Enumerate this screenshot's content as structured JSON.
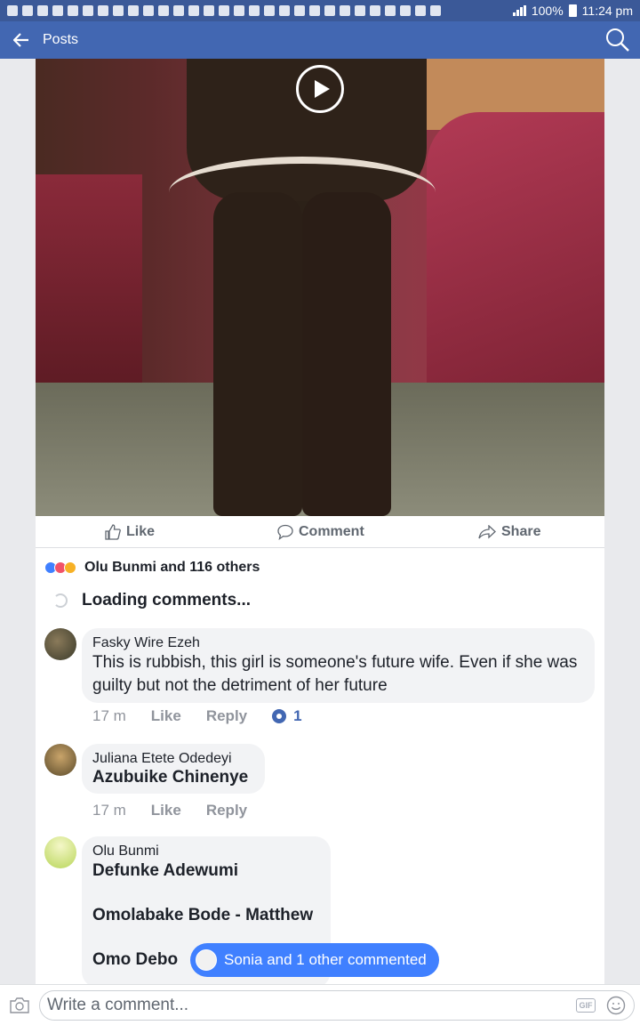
{
  "status_bar": {
    "battery": "100%",
    "time": "11:24 pm"
  },
  "app_bar": {
    "title": "Posts"
  },
  "post_actions": {
    "like": "Like",
    "comment": "Comment",
    "share": "Share"
  },
  "reactions": {
    "summary": "Olu Bunmi and 116 others",
    "colors": [
      "#4080ff",
      "#f25268",
      "#f7b125"
    ]
  },
  "loading": {
    "text": "Loading comments..."
  },
  "comments": [
    {
      "author": "Fasky Wire Ezeh",
      "text": "This is rubbish, this girl is someone's future wife. Even if she was guilty but not the detriment of her future",
      "time": "17 m",
      "like": "Like",
      "reply": "Reply",
      "like_count": "1"
    },
    {
      "author": "Juliana Etete Odedeyi",
      "tag": "Azubuike Chinenye",
      "time": "17 m",
      "like": "Like",
      "reply": "Reply"
    },
    {
      "author": "Olu Bunmi",
      "tags": [
        "Defunke Adewumi",
        "Omolabake Bode - Matthew",
        "Omo Debo"
      ]
    }
  ],
  "new_comments_pill": {
    "text": "Sonia and 1 other commented"
  },
  "composer": {
    "placeholder": "Write a comment...",
    "gif": "GIF"
  },
  "colors": {
    "status_bar": "#3b5998",
    "app_bar": "#4267b2",
    "pill": "#4080ff"
  }
}
